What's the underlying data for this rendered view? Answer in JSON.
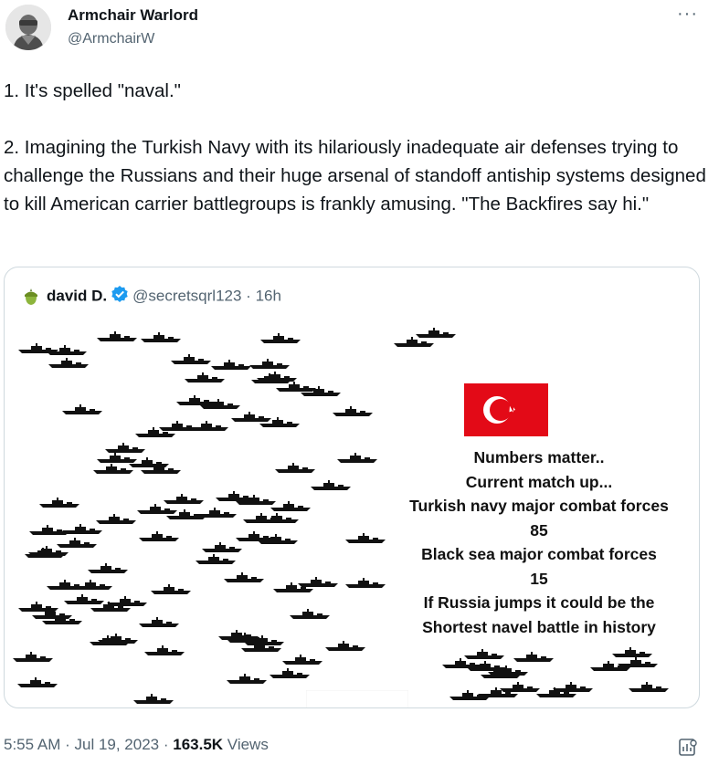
{
  "author": {
    "name": "Armchair Warlord",
    "handle": "@ArmchairW"
  },
  "menu": {
    "more_label": "···"
  },
  "tweet": {
    "paragraph1": "1. It's spelled \"naval.\"",
    "paragraph2": "2. Imagining the Turkish Navy with its hilariously inadequate air defenses trying to challenge the Russians and their huge arsenal of standoff antiship systems designed to kill American carrier battlegroups is frankly amusing.  \"The Backfires say hi.\""
  },
  "quoted_tweet": {
    "name": "david D.",
    "handle": "@secretsqrl123",
    "separator": "·",
    "time": "16h",
    "badge_color": "#1d9bf0",
    "image": {
      "caption_lines": [
        "Numbers matter..",
        "Current match up...",
        "Turkish navy major combat forces",
        "85",
        "Black sea major combat forces",
        "15",
        "If Russia jumps it could be the",
        "Shortest navel battle in history"
      ],
      "turkish_ship_count": 85,
      "russian_ship_count": 15,
      "colors": {
        "turkey_red": "#e30a17",
        "russia_white": "#ffffff",
        "russia_blue": "#0039a6",
        "russia_red": "#d52b1e",
        "ship": "#111111"
      }
    }
  },
  "footer": {
    "time": "5:55 AM",
    "separator1": " · ",
    "date": "Jul 19, 2023",
    "separator2": " · ",
    "views_count": "163.5K",
    "views_label": " Views"
  },
  "icons": {
    "avatar": "avatar",
    "more": "more-icon",
    "verified": "verified-badge-icon",
    "views": "views-analytics-icon"
  }
}
